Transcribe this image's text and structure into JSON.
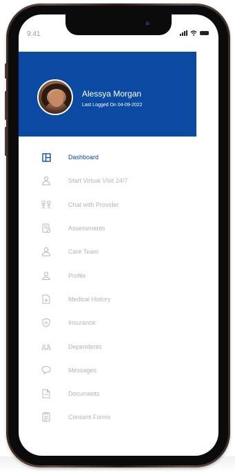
{
  "status_bar": {
    "time": "9:41"
  },
  "profile": {
    "name": "Alessya Morgan",
    "last_login": "Last Logged On 04-09-2022"
  },
  "colors": {
    "accent": "#0b4aa2",
    "inactive": "#b4b4b4"
  },
  "menu": {
    "items": [
      {
        "label": "Dashboard",
        "icon": "dashboard-icon",
        "active": true
      },
      {
        "label": "Start Virtual Visit 24/7",
        "icon": "virtual-visit-icon",
        "active": false
      },
      {
        "label": "Chat with Provider",
        "icon": "chat-provider-icon",
        "active": false
      },
      {
        "label": "Assessments",
        "icon": "assessments-icon",
        "active": false
      },
      {
        "label": "Care Team",
        "icon": "care-team-icon",
        "active": false
      },
      {
        "label": "Profile",
        "icon": "profile-icon",
        "active": false
      },
      {
        "label": "Medical History",
        "icon": "medical-history-icon",
        "active": false
      },
      {
        "label": "Insurance",
        "icon": "insurance-icon",
        "active": false
      },
      {
        "label": "Dependents",
        "icon": "dependents-icon",
        "active": false
      },
      {
        "label": "Messages",
        "icon": "messages-icon",
        "active": false
      },
      {
        "label": "Documents",
        "icon": "documents-icon",
        "active": false
      },
      {
        "label": "Consent Forms",
        "icon": "consent-forms-icon",
        "active": false
      }
    ]
  }
}
